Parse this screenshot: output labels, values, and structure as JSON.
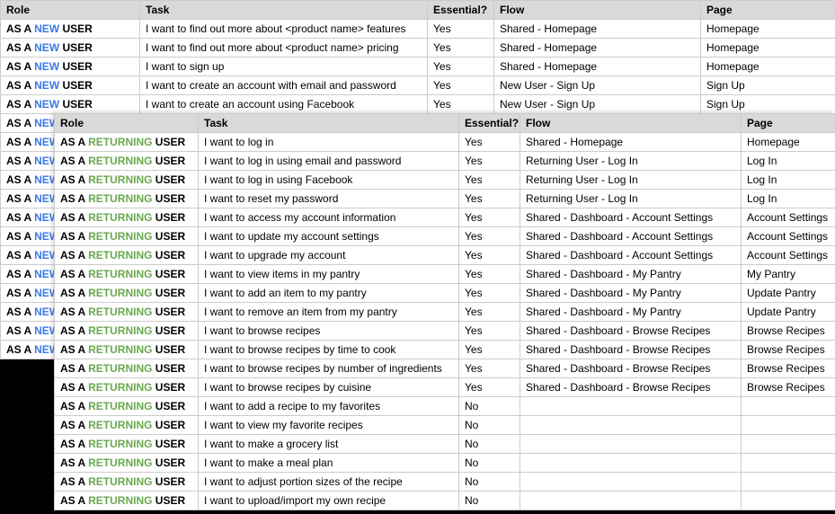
{
  "headers": {
    "role": "Role",
    "task": "Task",
    "essential": "Essential?",
    "flow": "Flow",
    "page": "Page"
  },
  "role_tokens": {
    "as_a": "AS A ",
    "new": "NEW",
    "returning": "RETURNING",
    "user": " USER"
  },
  "back_rows": [
    {
      "type": "new",
      "task": "I want to find out more about <product name> features",
      "essential": "Yes",
      "flow": "Shared - Homepage",
      "page": "Homepage"
    },
    {
      "type": "new",
      "task": "I want to find out more about <product name> pricing",
      "essential": "Yes",
      "flow": "Shared - Homepage",
      "page": "Homepage"
    },
    {
      "type": "new",
      "task": "I want to sign up",
      "essential": "Yes",
      "flow": "Shared - Homepage",
      "page": "Homepage"
    },
    {
      "type": "new",
      "task": "I want to create an account with email and password",
      "essential": "Yes",
      "flow": "New User - Sign Up",
      "page": "Sign Up"
    },
    {
      "type": "new",
      "task": "I want to create an account using Facebook",
      "essential": "Yes",
      "flow": "New User - Sign Up",
      "page": "Sign Up"
    },
    {
      "type": "new_trunc",
      "task": "",
      "essential": "",
      "flow": "",
      "page": ""
    },
    {
      "type": "new_trunc",
      "task": "",
      "essential": "",
      "flow": "",
      "page": ""
    },
    {
      "type": "new_trunc",
      "task": "",
      "essential": "",
      "flow": "",
      "page": ""
    },
    {
      "type": "new_trunc",
      "task": "",
      "essential": "",
      "flow": "",
      "page": ""
    },
    {
      "type": "new_trunc",
      "task": "",
      "essential": "",
      "flow": "",
      "page": ""
    },
    {
      "type": "new_trunc",
      "task": "",
      "essential": "",
      "flow": "",
      "page": ""
    },
    {
      "type": "new_trunc",
      "task": "",
      "essential": "",
      "flow": "",
      "page": ""
    },
    {
      "type": "new_trunc",
      "task": "",
      "essential": "",
      "flow": "",
      "page": ""
    },
    {
      "type": "new_trunc",
      "task": "",
      "essential": "",
      "flow": "",
      "page": ""
    },
    {
      "type": "new_trunc",
      "task": "",
      "essential": "",
      "flow": "",
      "page": ""
    },
    {
      "type": "new_trunc",
      "task": "",
      "essential": "",
      "flow": "",
      "page": ""
    },
    {
      "type": "new_trunc",
      "task": "",
      "essential": "",
      "flow": "",
      "page": ""
    },
    {
      "type": "new_trunc",
      "task": "",
      "essential": "",
      "flow": "",
      "page": ""
    }
  ],
  "front_rows": [
    {
      "type": "ret",
      "task": "I want to log in",
      "essential": "Yes",
      "flow": "Shared - Homepage",
      "page": "Homepage"
    },
    {
      "type": "ret",
      "task": "I want to log in using email and password",
      "essential": "Yes",
      "flow": "Returning User - Log In",
      "page": "Log In"
    },
    {
      "type": "ret",
      "task": "I want to log in using Facebook",
      "essential": "Yes",
      "flow": "Returning User - Log In",
      "page": "Log In"
    },
    {
      "type": "ret",
      "task": "I want to reset my password",
      "essential": "Yes",
      "flow": "Returning User - Log In",
      "page": "Log In"
    },
    {
      "type": "ret",
      "task": "I want to access my account information",
      "essential": "Yes",
      "flow": "Shared - Dashboard - Account Settings",
      "page": "Account Settings"
    },
    {
      "type": "ret",
      "task": "I want to update my account settings",
      "essential": "Yes",
      "flow": "Shared - Dashboard - Account Settings",
      "page": "Account Settings"
    },
    {
      "type": "ret",
      "task": "I want to upgrade my account",
      "essential": "Yes",
      "flow": "Shared - Dashboard - Account Settings",
      "page": "Account Settings"
    },
    {
      "type": "ret",
      "task": "I want to view items in my pantry",
      "essential": "Yes",
      "flow": "Shared - Dashboard - My Pantry",
      "page": "My Pantry"
    },
    {
      "type": "ret",
      "task": "I want to add an item to my pantry",
      "essential": "Yes",
      "flow": "Shared - Dashboard - My Pantry",
      "page": "Update Pantry"
    },
    {
      "type": "ret",
      "task": "I want to remove an item from my pantry",
      "essential": "Yes",
      "flow": "Shared - Dashboard - My Pantry",
      "page": "Update Pantry"
    },
    {
      "type": "ret",
      "task": "I want to browse recipes",
      "essential": "Yes",
      "flow": "Shared - Dashboard - Browse Recipes",
      "page": "Browse Recipes"
    },
    {
      "type": "ret",
      "task": "I want to browse recipes by time to cook",
      "essential": "Yes",
      "flow": "Shared - Dashboard - Browse Recipes",
      "page": "Browse Recipes"
    },
    {
      "type": "ret",
      "task": "I want to browse recipes by number of ingredients",
      "essential": "Yes",
      "flow": "Shared - Dashboard - Browse Recipes",
      "page": "Browse Recipes"
    },
    {
      "type": "ret",
      "task": "I want to browse recipes by cuisine",
      "essential": "Yes",
      "flow": "Shared - Dashboard - Browse Recipes",
      "page": "Browse Recipes"
    },
    {
      "type": "ret",
      "task": "I want to add a recipe to my favorites",
      "essential": "No",
      "flow": "",
      "page": ""
    },
    {
      "type": "ret",
      "task": "I want to view my favorite recipes",
      "essential": "No",
      "flow": "",
      "page": ""
    },
    {
      "type": "ret",
      "task": "I want to make a grocery list",
      "essential": "No",
      "flow": "",
      "page": ""
    },
    {
      "type": "ret",
      "task": "I want to make a meal plan",
      "essential": "No",
      "flow": "",
      "page": ""
    },
    {
      "type": "ret",
      "task": "I want to adjust portion sizes of the recipe",
      "essential": "No",
      "flow": "",
      "page": ""
    },
    {
      "type": "ret",
      "task": "I want to upload/import my own recipe",
      "essential": "No",
      "flow": "",
      "page": ""
    }
  ]
}
